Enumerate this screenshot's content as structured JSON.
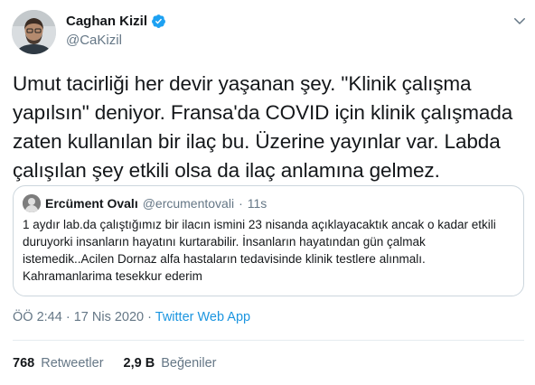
{
  "author": {
    "name": "Caghan Kizil",
    "handle": "@CaKizil",
    "verified_icon": "verified-badge-icon",
    "colors": {
      "verified": "#1da1f2"
    }
  },
  "tweet": {
    "text": "Umut tacirliği her devir yaşanan şey. \"Klinik çalışma yapılsın\" deniyor. Fransa'da COVID için klinik çalışmada zaten kullanılan bir ilaç bu. Üzerine yayınlar var. Labda çalışılan şey etkili olsa da ilaç anlamına gelmez."
  },
  "quote": {
    "name": "Ercüment Ovalı",
    "handle": "@ercumentovali",
    "separator": "·",
    "time": "11s",
    "text": "1 aydır lab.da çalıştığımız bir ilacın ismini 23 nisanda açıklayacaktık ancak o kadar etkili duruyorki insanların hayatını kurtarabilir.  İnsanların hayatından gün çalmak istemedik..Acilen Dornaz alfa hastaların tedavisinde klinik testlere alınmalı. Kahramanlarima tesekkur ederim"
  },
  "meta": {
    "time": "ÖÖ 2:44",
    "separator1": "·",
    "date": "17 Nis 2020",
    "separator2": "·",
    "source": "Twitter Web App"
  },
  "stats": {
    "retweets_count": "768",
    "retweets_label": "Retweetler",
    "likes_count": "2,9 B",
    "likes_label": "Beğeniler"
  },
  "colors": {
    "link": "#1b95e0",
    "secondary_text": "#657786",
    "border": "#ccd6dd"
  }
}
